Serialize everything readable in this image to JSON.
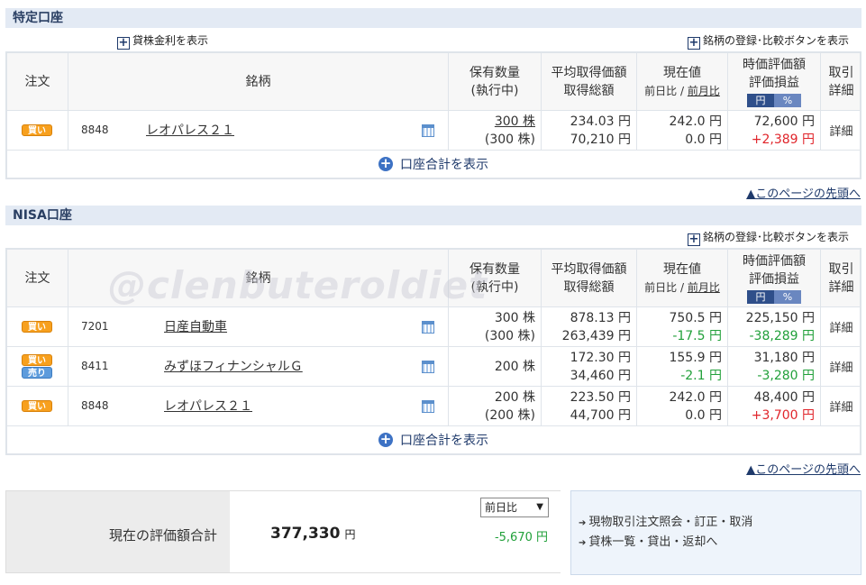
{
  "section1": {
    "title": "特定口座",
    "lending_toggle": "貸株金利を表示",
    "register_toggle": "銘柄の登録･比較ボタンを表示",
    "headers": {
      "order": "注文",
      "name": "銘柄",
      "qty1": "保有数量",
      "qty2": "(執行中)",
      "avg1": "平均取得価額",
      "avg2": "取得総額",
      "cur1": "現在値",
      "cur2a": "前日比",
      "cur2sep": " / ",
      "cur2b": "前月比",
      "val1": "時価評価額",
      "val2": "評価損益",
      "unit_yen": "円",
      "unit_pct": "%",
      "det1": "取引",
      "det2": "詳細"
    },
    "rows": [
      {
        "badges": [
          "買い"
        ],
        "code": "8848",
        "name": "レオパレス２１",
        "qty": "300 株",
        "qty_pending": "(300 株)",
        "avg": "234.03 円",
        "total_cost": "70,210 円",
        "price": "242.0 円",
        "change": "0.0 円",
        "market_value": "72,600 円",
        "pl": "+2,389 円",
        "detail": "詳細"
      }
    ],
    "sum_toggle": "口座合計を表示",
    "page_top": "▲このページの先頭へ"
  },
  "section2": {
    "title": "NISA口座",
    "register_toggle": "銘柄の登録･比較ボタンを表示",
    "rows": [
      {
        "badges": [
          "買い"
        ],
        "code": "7201",
        "name": "日産自動車",
        "qty": "300 株",
        "qty_pending": "(300 株)",
        "avg": "878.13 円",
        "total_cost": "263,439 円",
        "price": "750.5 円",
        "change": "-17.5 円",
        "market_value": "225,150 円",
        "pl": "-38,289 円",
        "detail": "詳細"
      },
      {
        "badges": [
          "買い",
          "売り"
        ],
        "code": "8411",
        "name": "みずほフィナンシャルＧ",
        "qty": "200 株",
        "qty_pending": "",
        "avg": "172.30 円",
        "total_cost": "34,460 円",
        "price": "155.9 円",
        "change": "-2.1 円",
        "market_value": "31,180 円",
        "pl": "-3,280 円",
        "detail": "詳細"
      },
      {
        "badges": [
          "買い"
        ],
        "code": "8848",
        "name": "レオパレス２１",
        "qty": "200 株",
        "qty_pending": "(200 株)",
        "avg": "223.50 円",
        "total_cost": "44,700 円",
        "price": "242.0 円",
        "change": "0.0 円",
        "market_value": "48,400 円",
        "pl": "+3,700 円",
        "detail": "詳細"
      }
    ],
    "sum_toggle": "口座合計を表示",
    "page_top": "▲このページの先頭へ"
  },
  "summary": {
    "label": "現在の評価額合計",
    "value": "377,330",
    "yen": "円",
    "select_value": "前日比",
    "diff": "-5,670 円"
  },
  "links": [
    "現物取引注文照会・訂正・取消",
    "貸株一覧・貸出・返却へ"
  ],
  "watermark": "@clenbuteroldiet",
  "colors": {
    "buy": "#f7a01e",
    "sell": "#5d9bdc",
    "positive": "#e0242a",
    "negative": "#21a03a",
    "header_bg": "#e3eaf4"
  }
}
